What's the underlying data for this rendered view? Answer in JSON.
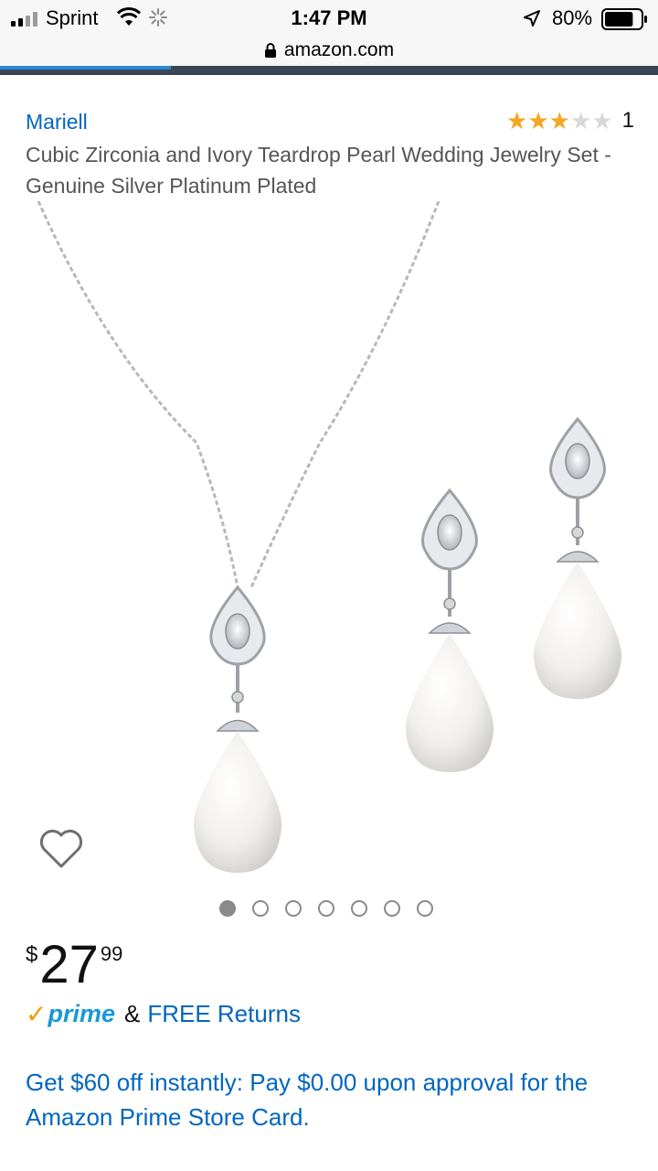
{
  "status_bar": {
    "carrier": "Sprint",
    "time": "1:47 PM",
    "battery": "80%",
    "battery_level": 0.8,
    "icons": [
      "signal-icon",
      "wifi-icon",
      "activity-icon",
      "location-icon",
      "battery-icon"
    ]
  },
  "browser": {
    "url": "amazon.com",
    "load_progress": 0.26,
    "icons": [
      "lock-icon"
    ]
  },
  "product": {
    "brand": "Mariell",
    "rating_stars": 3,
    "rating_max": 5,
    "rating_count": "1",
    "title": "Cubic Zirconia and Ivory Teardrop Pearl Wedding Jewelry Set - Genuine Silver Platinum Plated",
    "image_count": 7,
    "image_index": 1,
    "price": {
      "currency": "$",
      "whole": "27",
      "fraction": "99"
    },
    "shipping": {
      "prime_check": "✓",
      "prime_word": "prime",
      "amp": "&",
      "returns": "FREE Returns"
    },
    "promo": "Get $60 off instantly: Pay $0.00 upon approval for the Amazon Prime Store Card."
  },
  "colors": {
    "link": "#0066c0",
    "star": "#f5a623",
    "prime_blue": "#1a98d5",
    "prime_orange": "#f49a00",
    "progress": "#2f89d4"
  }
}
